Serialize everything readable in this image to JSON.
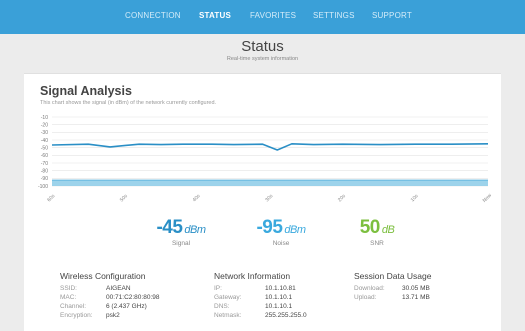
{
  "nav": {
    "items": [
      {
        "label": "CONNECTION",
        "active": false
      },
      {
        "label": "STATUS",
        "active": true
      },
      {
        "label": "FAVORITES",
        "active": false
      },
      {
        "label": "SETTINGS",
        "active": false
      },
      {
        "label": "SUPPORT",
        "active": false
      }
    ]
  },
  "header": {
    "title": "Status",
    "subtitle": "Real-time system information"
  },
  "signal": {
    "title": "Signal Analysis",
    "description": "This chart shows the signal (in dBm) of the network currently configured."
  },
  "chart_data": {
    "type": "area",
    "title": "",
    "xlabel": "",
    "ylabel": "",
    "y_ticks": [
      -10,
      -20,
      -30,
      -40,
      -50,
      -60,
      -70,
      -80,
      -90,
      -100
    ],
    "ylim": [
      -100,
      -10
    ],
    "x_ticks": [
      "60s",
      "50s",
      "40s",
      "30s",
      "20s",
      "10s",
      "Now"
    ],
    "grid": true,
    "series": [
      {
        "color": "#2a8fc6",
        "x": [
          -60,
          -55,
          -52,
          -48,
          -45,
          -42,
          -38,
          -35,
          -31,
          -29,
          -27,
          -24,
          -20,
          -15,
          -10,
          -5,
          0
        ],
        "values": [
          -46.5,
          -45.5,
          -49,
          -45.5,
          -46,
          -45.5,
          -45.5,
          -46,
          -45.5,
          -53,
          -45,
          -46,
          -45.5,
          -46,
          -45.5,
          -45.5,
          -45
        ]
      },
      {
        "color": "#8ccbe8",
        "x": [
          -60,
          0
        ],
        "values": [
          -95,
          -95
        ]
      }
    ]
  },
  "metrics": [
    {
      "value": "-45",
      "unit": "dBm",
      "label": "Signal",
      "color": "#2a8fc6"
    },
    {
      "value": "-95",
      "unit": "dBm",
      "label": "Noise",
      "color": "#3aa9de"
    },
    {
      "value": "50",
      "unit": "dB",
      "label": "SNR",
      "color": "#7cbf3f"
    }
  ],
  "wireless": {
    "title": "Wireless Configuration",
    "rows": [
      {
        "key": "SSID:",
        "value": "AIGEAN"
      },
      {
        "key": "MAC:",
        "value": "00:71:C2:80:80:98"
      },
      {
        "key": "Channel:",
        "value": "6 (2.437 GHz)"
      },
      {
        "key": "Encryption:",
        "value": "psk2"
      }
    ]
  },
  "network": {
    "title": "Network Information",
    "rows": [
      {
        "key": "IP:",
        "value": "10.1.10.81"
      },
      {
        "key": "Gateway:",
        "value": "10.1.10.1"
      },
      {
        "key": "DNS:",
        "value": "10.1.10.1"
      },
      {
        "key": "Netmask:",
        "value": "255.255.255.0"
      }
    ]
  },
  "session": {
    "title": "Session Data Usage",
    "rows": [
      {
        "key": "Download:",
        "value": "30.05 MB"
      },
      {
        "key": "Upload:",
        "value": "13.71 MB"
      }
    ]
  }
}
